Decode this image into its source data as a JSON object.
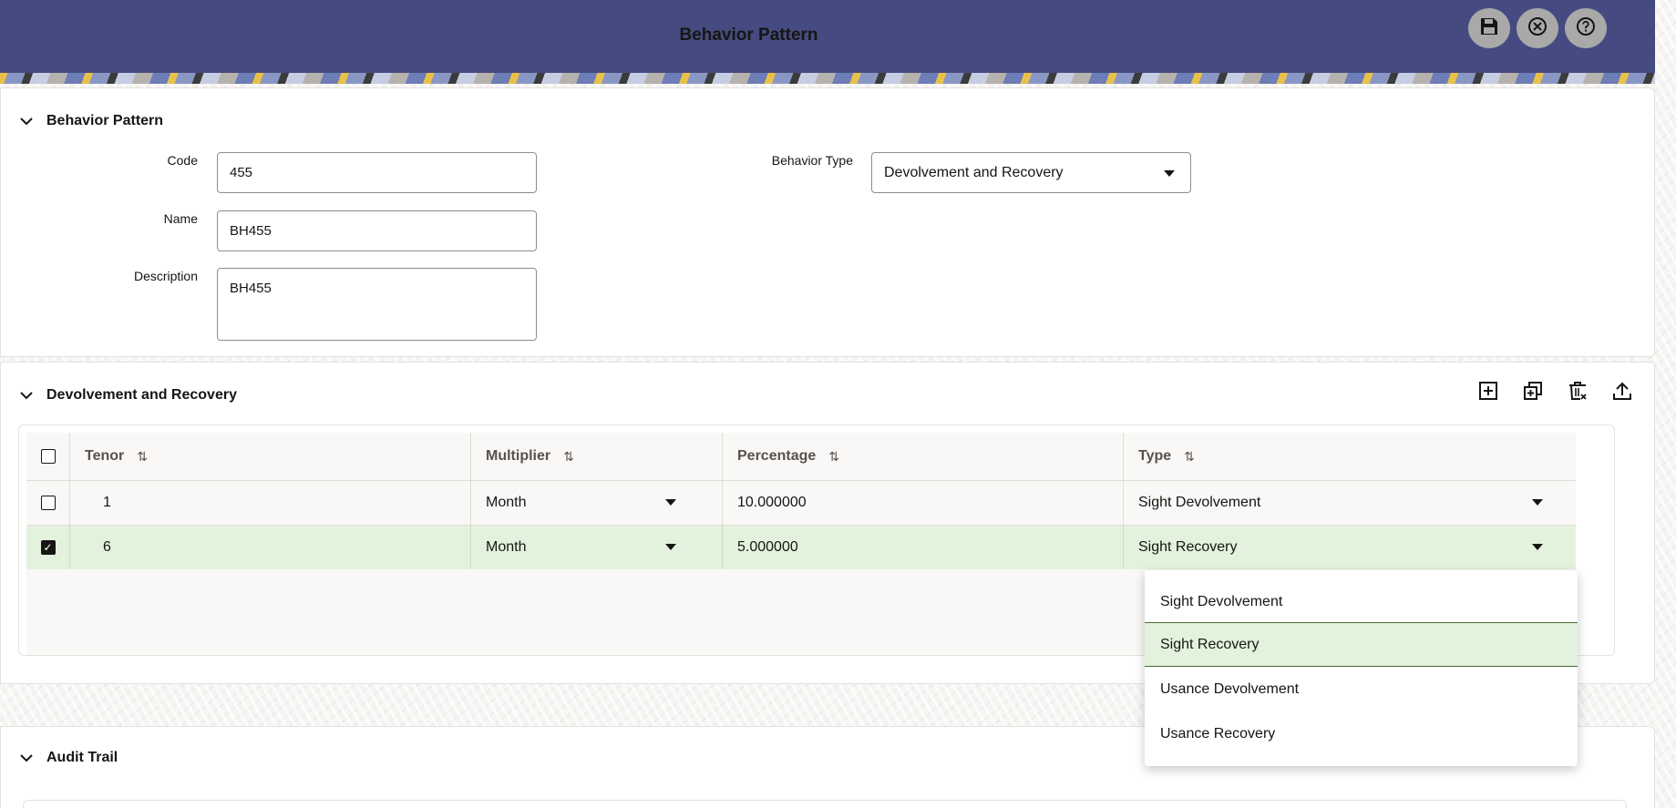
{
  "header": {
    "title": "Behavior Pattern",
    "actions": [
      {
        "name": "save",
        "icon": "save-icon"
      },
      {
        "name": "close",
        "icon": "close-circle-icon"
      },
      {
        "name": "help",
        "icon": "help-circle-icon"
      }
    ]
  },
  "behavior_pattern": {
    "section_title": "Behavior Pattern",
    "code_label": "Code",
    "code_value": "455",
    "name_label": "Name",
    "name_value": "BH455",
    "description_label": "Description",
    "description_value": "BH455",
    "behavior_type_label": "Behavior Type",
    "behavior_type_value": "Devolvement and Recovery"
  },
  "devolvement": {
    "section_title": "Devolvement and Recovery",
    "toolbar": [
      "add-icon",
      "add-multiple-icon",
      "delete-icon",
      "upload-icon"
    ],
    "columns": [
      "Tenor",
      "Multiplier",
      "Percentage",
      "Type"
    ],
    "rows": [
      {
        "selected": false,
        "tenor": "1",
        "multiplier": "Month",
        "percentage": "10.000000",
        "type": "Sight Devolvement"
      },
      {
        "selected": true,
        "tenor": "6",
        "multiplier": "Month",
        "percentage": "5.000000",
        "type": "Sight Recovery"
      }
    ],
    "type_dropdown": {
      "options": [
        "Sight Devolvement",
        "Sight Recovery",
        "Usance Devolvement",
        "Usance Recovery"
      ],
      "selected": "Sight Recovery"
    }
  },
  "audit": {
    "section_title": "Audit Trail"
  }
}
